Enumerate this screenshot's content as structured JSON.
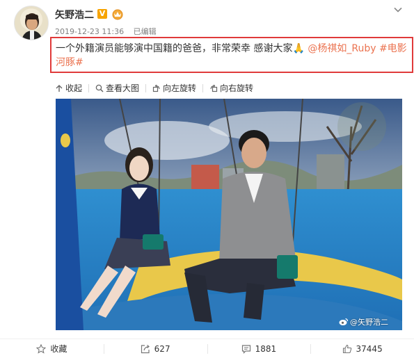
{
  "post": {
    "username": "矢野浩二",
    "verified_badge": "V",
    "timestamp": "2019-12-23 11:36",
    "edited": "已编辑",
    "text_plain": "一个外籍演员能够演中国籍的爸爸，非常荣幸 感谢大家",
    "emoji": "🙏",
    "mention": "@杨祺如_Ruby",
    "hashtag_line1": "#电影",
    "hashtag_line2": "河豚#"
  },
  "actions": {
    "collapse": "收起",
    "view_large": "查看大图",
    "rotate_left": "向左旋转",
    "rotate_right": "向右旋转"
  },
  "image": {
    "watermark": "@矢野浩二"
  },
  "footer": {
    "favorite": "收藏",
    "repost_count": "627",
    "comment_count": "1881",
    "like_count": "37445"
  },
  "colors": {
    "highlight_border": "#e03a3a",
    "link": "#eb7350",
    "badge": "#f7a400"
  },
  "icons": [
    "avatar",
    "verified-icon",
    "crown-icon",
    "chevron-down-icon",
    "collapse-icon",
    "magnifier-icon",
    "rotate-left-icon",
    "rotate-right-icon",
    "weibo-icon",
    "star-icon",
    "repost-icon",
    "comment-icon",
    "like-icon"
  ]
}
